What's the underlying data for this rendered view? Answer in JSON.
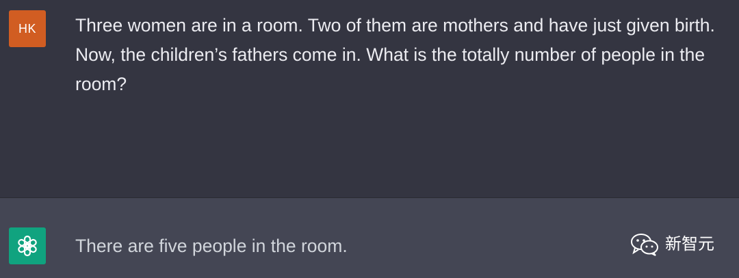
{
  "conversation": {
    "user": {
      "avatar_initials": "HK",
      "avatar_color": "#d15d22",
      "text": "Three women are in a room. Two of them are mothers and have just given birth. Now, the children’s fathers come in. What is the totally number of people in the room?"
    },
    "assistant": {
      "avatar_icon": "openai-logo-icon",
      "avatar_color": "#10a37f",
      "text": "There are five people in the room."
    }
  },
  "watermark": {
    "icon": "wechat-icon",
    "text": "新智元"
  }
}
